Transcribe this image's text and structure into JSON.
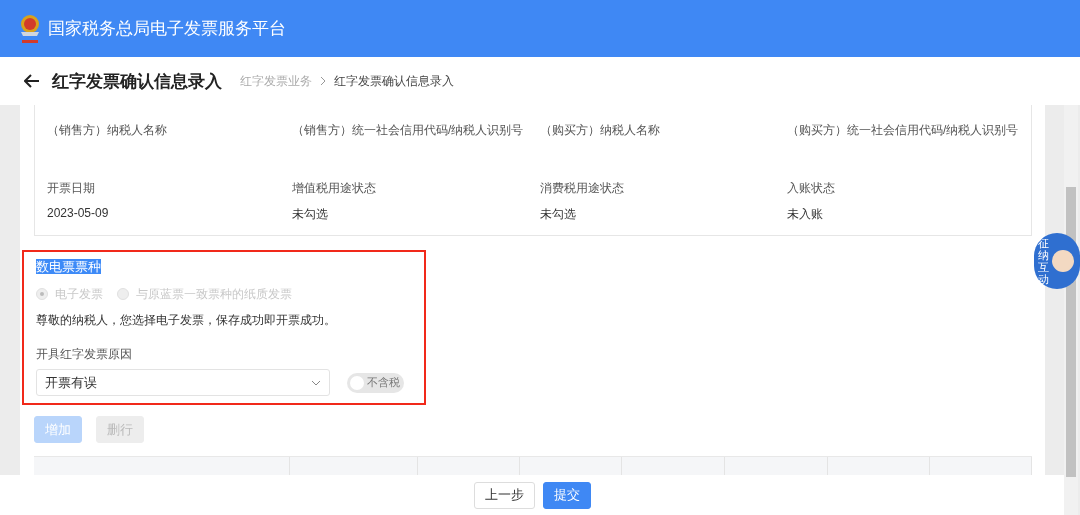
{
  "header": {
    "title": "国家税务总局电子发票服务平台"
  },
  "page": {
    "title": "红字发票确认信息录入",
    "breadcrumb": [
      {
        "label": "红字发票业务",
        "current": false
      },
      {
        "label": "红字发票确认信息录入",
        "current": true
      }
    ]
  },
  "info_fields": [
    {
      "label": "（销售方）纳税人名称"
    },
    {
      "label": "（销售方）统一社会信用代码/纳税人识别号"
    },
    {
      "label": "（购买方）纳税人名称"
    },
    {
      "label": "（购买方）统一社会信用代码/纳税人识别号"
    },
    {
      "label": "开票日期",
      "value": "2023-05-09"
    },
    {
      "label": "增值税用途状态",
      "value": "未勾选"
    },
    {
      "label": "消费税用途状态",
      "value": "未勾选"
    },
    {
      "label": "入账状态",
      "value": "未入账"
    }
  ],
  "invoice_type": {
    "title": "数电票票种",
    "title_highlighted": true,
    "highlighted": true,
    "options": [
      {
        "label": "电子发票",
        "selected": true,
        "disabled": true
      },
      {
        "label": "与原蓝票一致票种的纸质发票",
        "selected": false,
        "disabled": true
      }
    ],
    "notice": "尊敬的纳税人，您选择电子发票，保存成功即开票成功。"
  },
  "reason": {
    "label": "开具红字发票原因",
    "value": "开票有误"
  },
  "tax_toggle": {
    "label": "不含税",
    "on": false,
    "disabled": true
  },
  "row_buttons": [
    {
      "label": "增加",
      "kind": "primary",
      "disabled": true
    },
    {
      "label": "删行",
      "kind": "default",
      "disabled": true
    }
  ],
  "assistant": {
    "label": "征纳互动"
  },
  "footer_buttons": [
    {
      "label": "上一步",
      "kind": "default"
    },
    {
      "label": "提交",
      "kind": "primary"
    }
  ]
}
